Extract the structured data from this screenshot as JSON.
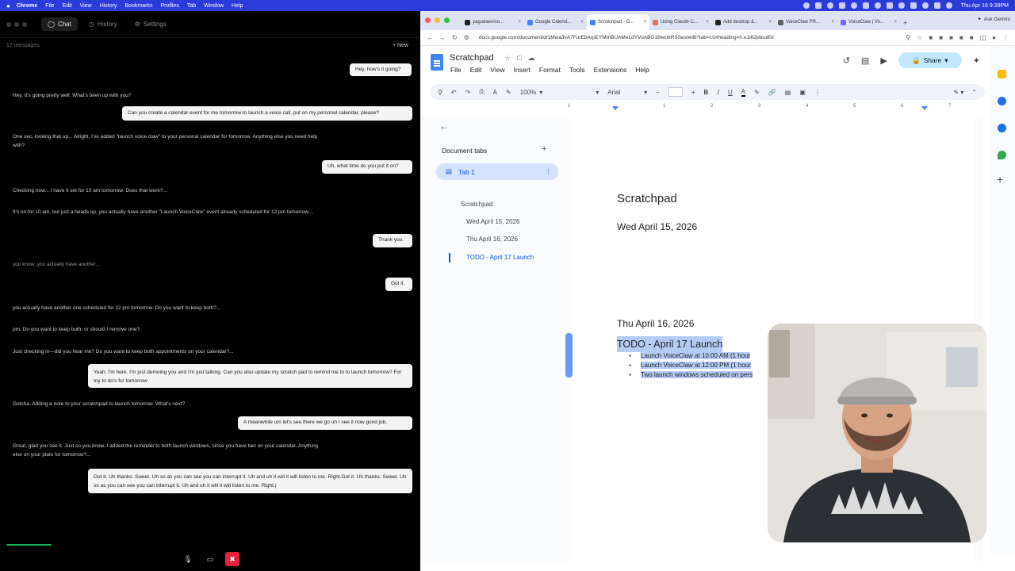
{
  "menubar": {
    "app": "Chrome",
    "items": [
      "File",
      "Edit",
      "View",
      "History",
      "Bookmarks",
      "Profiles",
      "Tab",
      "Window",
      "Help"
    ],
    "clock": "Thu Apr 16  9:39PM"
  },
  "chat": {
    "tabs": [
      {
        "label": "Chat",
        "icon": "chat-icon"
      },
      {
        "label": "History",
        "icon": "clock-icon"
      },
      {
        "label": "Settings",
        "icon": "gear-icon"
      }
    ],
    "message_count": "17 messages",
    "new_label": "New",
    "messages": [
      {
        "role": "user",
        "text": "Hey, how's it going?"
      },
      {
        "role": "bot",
        "text": "Hey. It's going pretty well. What's been up with you?"
      },
      {
        "role": "user",
        "text": "Can you create a calendar event for me tomorrow to launch a voice call, put on my personal calendar, please?"
      },
      {
        "role": "bot",
        "text": "One sec, looking that up... Alright, I've added \"launch voice claw\" to your personal calendar for tomorrow. Anything else you need help with?"
      },
      {
        "role": "user",
        "text": "Uh, what time do you put it on?"
      },
      {
        "role": "bot",
        "text": "Checking now... I have it set for 10 am tomorrow. Does that work?..."
      },
      {
        "role": "bot",
        "text": "It's on for 10 am, but just a heads up, you actually have another \"Launch VoiceClaw\" event already scheduled for 12 pm tomorrow,..."
      },
      {
        "role": "user",
        "text": "Thank you."
      },
      {
        "role": "bot",
        "text": "you know, you actually have another..."
      },
      {
        "role": "user",
        "text": "Got it."
      },
      {
        "role": "bot",
        "text": "you actually have another one scheduled for 12 pm tomorrow. Do you want to keep both?..."
      },
      {
        "role": "bot",
        "text": "pm. Do you want to keep both, or should I remove one?"
      },
      {
        "role": "bot",
        "text": "Just checking in—did you hear me? Do you want to keep both appointments on your calendar?..."
      },
      {
        "role": "user",
        "text": "Yeah, I'm here. I'm just demoing you and I'm just talking. Can you also update my scratch pad to remind me to to launch tomorrow? For my to do's for tomorrow."
      },
      {
        "role": "bot",
        "text": "Gotcha. Adding a note to your scratchpad to launch tomorrow. What's next?"
      },
      {
        "role": "user",
        "text": "A meanwhile um let's see there we go uh I see it now good job."
      },
      {
        "role": "bot",
        "text": "Great, glad you see it. Just so you know, I added the reminder to both launch windows, since you have two on your calendar. Anything else on your plate for tomorrow?..."
      },
      {
        "role": "user",
        "text": "Got it. Uh thanks. Sweet. Uh so as you can see you can interrupt it. Uh and uh it will it will listen to me. Right.Got it. Uh thanks. Sweet. Uh so as you can see you can interrupt it. Uh and uh it will it will listen to me. Right.|"
      }
    ],
    "accent_green": "#18b35b",
    "end_call_color": "#e6213c"
  },
  "browser": {
    "tabs": [
      {
        "label": "yagudaev/vo...",
        "color": "#222222"
      },
      {
        "label": "Google Calend...",
        "color": "#4285f4"
      },
      {
        "label": "Scratchpad - G...",
        "color": "#4285f4",
        "active": true
      },
      {
        "label": "Using Claude C...",
        "color": "#d97757"
      },
      {
        "label": "Add desktop &...",
        "color": "#222222"
      },
      {
        "label": "VoiceClaw PR...",
        "color": "#5f6368"
      },
      {
        "label": "VoiceClaw | Vo...",
        "color": "#7b61ff"
      }
    ],
    "ask_gemini": "Ask Gemini",
    "url": "docs.google.com/document/d/1Mwa3vA7FurEbArpEYMmBUAMeLdYVuABO16wcIkRSSes/edit?tab=t.0#heading=h.e1l62jdzud0z"
  },
  "docs": {
    "title": "Scratchpad",
    "menus": [
      "File",
      "Edit",
      "View",
      "Insert",
      "Format",
      "Tools",
      "Extensions",
      "Help"
    ],
    "share_label": "Share",
    "zoom": "100%",
    "font": "Arial",
    "ruler_numbers": [
      "1",
      "1",
      "2",
      "3",
      "4",
      "5",
      "6",
      "7"
    ],
    "outline": {
      "header": "Document tabs",
      "tab": "Tab 1",
      "items": [
        "Scratchpad",
        "Wed April 15, 2026",
        "Thu April 16, 2026",
        "TODO - April 17 Launch"
      ]
    },
    "page": {
      "heading": "Scratchpad",
      "date1": "Wed April 15, 2026",
      "date2": "Thu April 16, 2026",
      "todo": "TODO - April 17 Launch",
      "bullets": [
        "Launch VoiceClaw at 10:00 AM (1 hour",
        "Launch VoiceClaw at 12:00 PM (1 hour",
        "Two launch windows scheduled on pers"
      ]
    },
    "highlight_color": "#b4ccf5",
    "share_color": "#c2e7ff"
  }
}
